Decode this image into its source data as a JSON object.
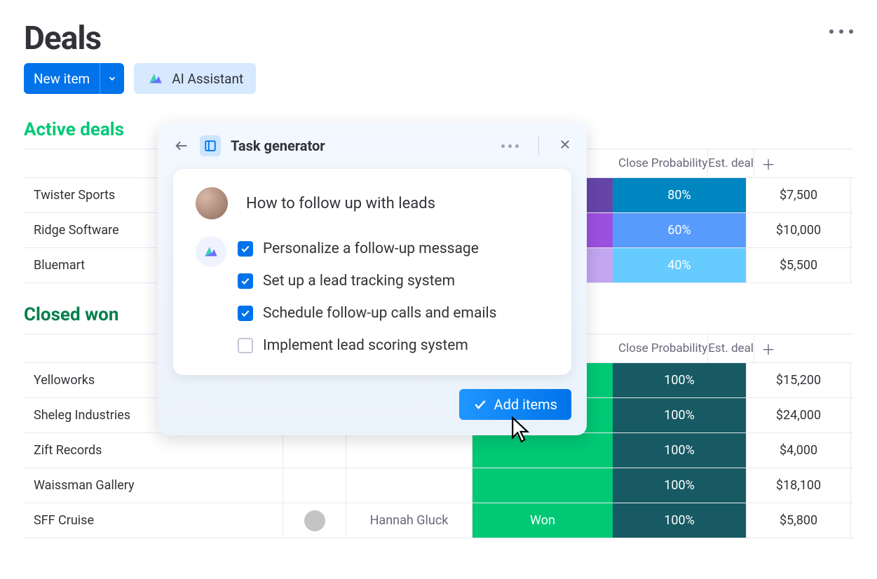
{
  "page_title": "Deals",
  "buttons": {
    "new_item": "New item",
    "ai_assistant": "AI Assistant"
  },
  "columns": {
    "close_prob": "Close Probability",
    "est_deal": "Est. deal"
  },
  "groups": {
    "active": {
      "title": "Active deals",
      "rows": [
        {
          "name": "Twister Sports",
          "stage_color": "#6645a9",
          "cp": "80%",
          "cp_color": "#0086c0",
          "ed": "$7,500"
        },
        {
          "name": "Ridge Software",
          "stage_color": "#9d50dd",
          "cp": "60%",
          "cp_color": "#579bfc",
          "ed": "$10,000"
        },
        {
          "name": "Bluemart",
          "stage_color": "#c3a6f0",
          "cp": "40%",
          "cp_color": "#66ccff",
          "ed": "$5,500"
        }
      ]
    },
    "closed": {
      "title": "Closed won",
      "rows": [
        {
          "name": "Yelloworks",
          "stage": "",
          "stage_color": "#00c875",
          "cp": "100%",
          "cp_color": "#175A63",
          "ed": "$15,200"
        },
        {
          "name": "Sheleg Industries",
          "stage": "",
          "stage_color": "#00c875",
          "cp": "100%",
          "cp_color": "#175A63",
          "ed": "$24,000"
        },
        {
          "name": "Zift Records",
          "stage": "",
          "stage_color": "#00c875",
          "cp": "100%",
          "cp_color": "#175A63",
          "ed": "$4,000"
        },
        {
          "name": "Waissman Gallery",
          "stage": "",
          "stage_color": "#00c875",
          "cp": "100%",
          "cp_color": "#175A63",
          "ed": "$18,100"
        },
        {
          "name": "SFF Cruise",
          "stage": "Won",
          "contact": "Hannah Gluck",
          "stage_color": "#00c875",
          "cp": "100%",
          "cp_color": "#175A63",
          "ed": "$5,800"
        }
      ]
    }
  },
  "modal": {
    "title": "Task generator",
    "prompt": "How to follow up with leads",
    "tasks": [
      {
        "label": "Personalize a follow-up message",
        "checked": true
      },
      {
        "label": "Set up a lead tracking system",
        "checked": true
      },
      {
        "label": "Schedule follow-up calls and emails",
        "checked": true
      },
      {
        "label": "Implement lead scoring system",
        "checked": false
      }
    ],
    "add_label": "Add items"
  }
}
